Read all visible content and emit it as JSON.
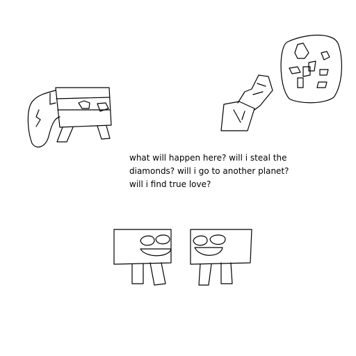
{
  "caption": {
    "line1": "what will happen here? will i steal the",
    "line2": "diamonds? will i go to another planet?",
    "line3": "will i find true love?"
  },
  "colors": {
    "background": "#ffffff",
    "ink": "#000000"
  }
}
